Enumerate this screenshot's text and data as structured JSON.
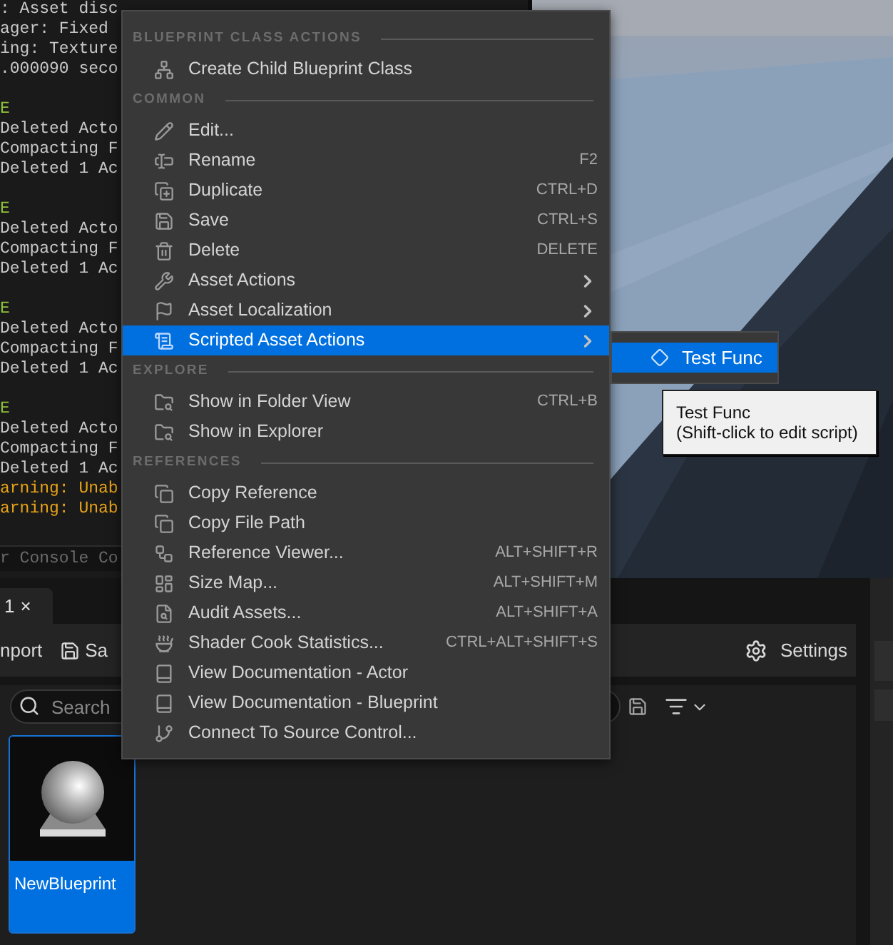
{
  "console": {
    "lines": [
      {
        "text": ": Asset disc",
        "kind": "info"
      },
      {
        "text": "ager: Fixed",
        "kind": "info"
      },
      {
        "text": "ing: Texture",
        "kind": "info"
      },
      {
        "text": ".000090 seco",
        "kind": "info"
      },
      {
        "text": "E",
        "kind": "header"
      },
      {
        "text": "Deleted Acto",
        "kind": "info"
      },
      {
        "text": "Compacting F",
        "kind": "info"
      },
      {
        "text": "Deleted 1 Ac",
        "kind": "info"
      },
      {
        "text": "E",
        "kind": "header"
      },
      {
        "text": "Deleted Acto",
        "kind": "info"
      },
      {
        "text": "Compacting F",
        "kind": "info"
      },
      {
        "text": "Deleted 1 Ac",
        "kind": "info"
      },
      {
        "text": "E",
        "kind": "header"
      },
      {
        "text": "Deleted Acto",
        "kind": "info"
      },
      {
        "text": "Compacting F",
        "kind": "info"
      },
      {
        "text": "Deleted 1 Ac",
        "kind": "info"
      },
      {
        "text": "E",
        "kind": "header"
      },
      {
        "text": "Deleted Acto",
        "kind": "info"
      },
      {
        "text": "Compacting F",
        "kind": "info"
      },
      {
        "text": "Deleted 1 Ac",
        "kind": "info"
      },
      {
        "text": "arning: Unab",
        "kind": "warning"
      },
      {
        "text": "arning: Unab",
        "kind": "warning"
      }
    ],
    "footer": "r Console Co"
  },
  "content_browser": {
    "tab": {
      "label": "1",
      "close": "×"
    },
    "toolbar": {
      "import": "nport",
      "save": "Sa",
      "settings": "Settings"
    },
    "search": {
      "placeholder": "Search"
    },
    "assets": [
      {
        "name": "NewBlueprint",
        "selected": true
      }
    ]
  },
  "context_menu": {
    "sections": [
      {
        "heading": "BLUEPRINT CLASS ACTIONS",
        "items": [
          {
            "label": "Create Child Blueprint Class",
            "has_submenu": false,
            "selected": false
          }
        ]
      },
      {
        "heading": "COMMON",
        "items": [
          {
            "label": "Edit...",
            "has_submenu": false,
            "selected": false
          },
          {
            "label": "Rename",
            "shortcut": "F2",
            "has_submenu": false,
            "selected": false
          },
          {
            "label": "Duplicate",
            "shortcut": "CTRL+D",
            "has_submenu": false,
            "selected": false
          },
          {
            "label": "Save",
            "shortcut": "CTRL+S",
            "has_submenu": false,
            "selected": false
          },
          {
            "label": "Delete",
            "shortcut": "DELETE",
            "has_submenu": false,
            "selected": false
          },
          {
            "label": "Asset Actions",
            "has_submenu": true,
            "selected": false
          },
          {
            "label": "Asset Localization",
            "has_submenu": true,
            "selected": false
          },
          {
            "label": "Scripted Asset Actions",
            "has_submenu": true,
            "selected": true
          }
        ]
      },
      {
        "heading": "EXPLORE",
        "items": [
          {
            "label": "Show in Folder View",
            "shortcut": "CTRL+B",
            "has_submenu": false,
            "selected": false
          },
          {
            "label": "Show in Explorer",
            "has_submenu": false,
            "selected": false
          }
        ]
      },
      {
        "heading": "REFERENCES",
        "items": [
          {
            "label": "Copy Reference",
            "has_submenu": false,
            "selected": false
          },
          {
            "label": "Copy File Path",
            "has_submenu": false,
            "selected": false
          },
          {
            "label": "Reference Viewer...",
            "shortcut": "ALT+SHIFT+R",
            "has_submenu": false,
            "selected": false
          },
          {
            "label": "Size Map...",
            "shortcut": "ALT+SHIFT+M",
            "has_submenu": false,
            "selected": false
          },
          {
            "label": "Audit Assets...",
            "shortcut": "ALT+SHIFT+A",
            "has_submenu": false,
            "selected": false
          },
          {
            "label": "Shader Cook Statistics...",
            "shortcut": "CTRL+ALT+SHIFT+S",
            "has_submenu": false,
            "selected": false
          },
          {
            "label": "View Documentation - Actor",
            "has_submenu": false,
            "selected": false
          },
          {
            "label": "View Documentation - Blueprint",
            "has_submenu": false,
            "selected": false
          },
          {
            "label": "Connect To Source Control...",
            "has_submenu": false,
            "selected": false
          }
        ]
      }
    ]
  },
  "submenu": {
    "items": [
      {
        "label": "Test Func",
        "selected": true
      }
    ]
  },
  "tooltip": {
    "title": "Test Func",
    "hint": "(Shift-click to edit script)"
  }
}
